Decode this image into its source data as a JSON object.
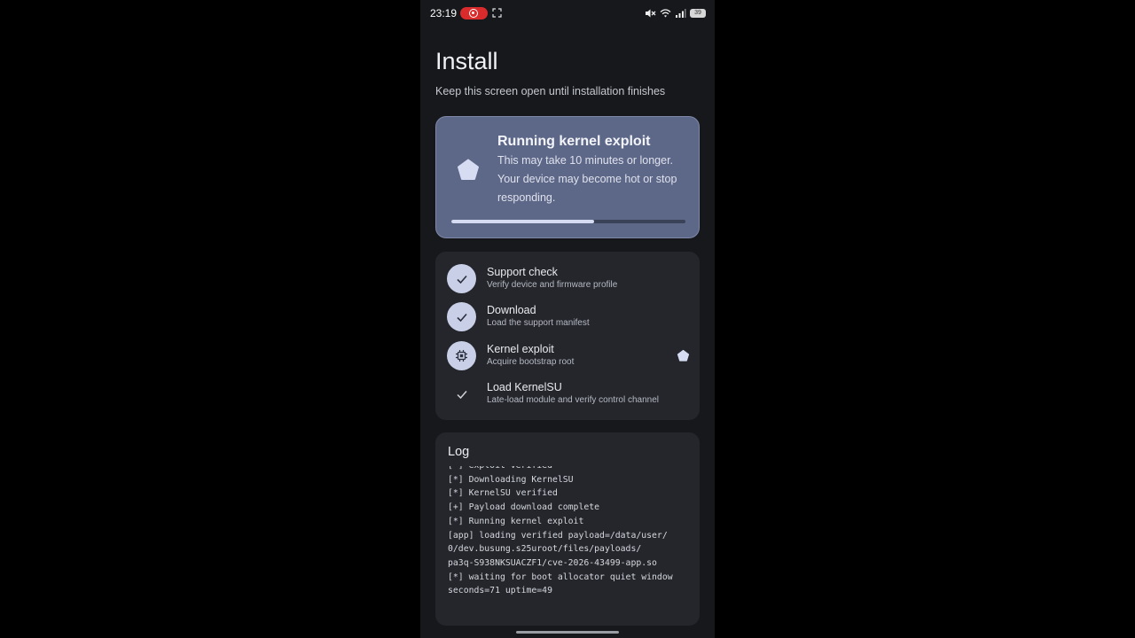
{
  "status_bar": {
    "time": "23:19",
    "battery": "39",
    "icons": [
      "screen-record-icon",
      "expand-icon",
      "mute-icon",
      "wifi-icon",
      "signal-icon",
      "battery-icon"
    ]
  },
  "header": {
    "title": "Install",
    "subtitle": "Keep this screen open until installation finishes"
  },
  "running": {
    "title": "Running kernel exploit",
    "description": "This may take 10 minutes or longer. Your device may become hot or stop responding.",
    "progress": 0.61,
    "icon": "pentagon-spinner-icon"
  },
  "steps": [
    {
      "label": "Support check",
      "sub": "Verify device and firmware profile",
      "state": "done",
      "icon": "check-icon"
    },
    {
      "label": "Download",
      "sub": "Load the support manifest",
      "state": "done",
      "icon": "check-icon"
    },
    {
      "label": "Kernel exploit",
      "sub": "Acquire bootstrap root",
      "state": "active",
      "icon": "chip-icon"
    },
    {
      "label": "Load KernelSU",
      "sub": "Late-load module and verify control channel",
      "state": "pending",
      "icon": "check-icon"
    }
  ],
  "log": {
    "title": "Log",
    "lines": [
      "[*] exploit verified",
      "[*] Downloading KernelSU",
      "[*] KernelSU verified",
      "[+] Payload download complete",
      "[*] Running kernel exploit",
      "[app] loading verified payload=/data/user/",
      "0/dev.busung.s25uroot/files/payloads/",
      "pa3q-S938NKSUACZF1/cve-2026-43499-app.so",
      "[*] waiting for boot allocator quiet window",
      "seconds=71 uptime=49"
    ]
  },
  "colors": {
    "background": "#17181c",
    "card": "#24262c",
    "accent_card": "#5d6787",
    "accent_light": "#c9cfe6"
  }
}
